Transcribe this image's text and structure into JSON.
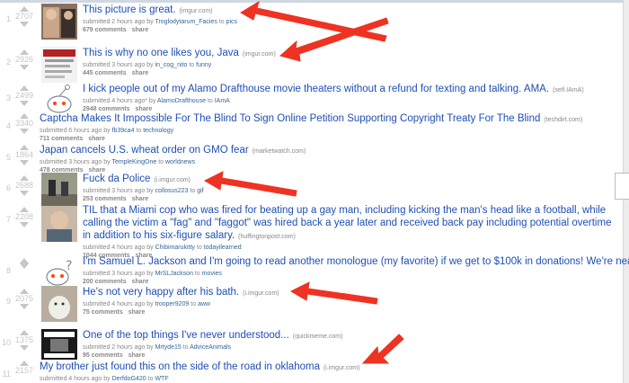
{
  "posts": [
    {
      "rank": "1",
      "score": "2707",
      "title": "This picture is great.",
      "domain": "(imgur.com)",
      "submitted": "submitted 2 hours ago by",
      "author": "Troglodytarum_Facies",
      "to": "to",
      "sub": "pics",
      "comments": "679 comments",
      "share": "share"
    },
    {
      "rank": "2",
      "score": "2926",
      "title": "This is why no one likes you, Java",
      "domain": "(imgur.com)",
      "submitted": "submitted 3 hours ago by",
      "author": "in_cog_nito",
      "to": "to",
      "sub": "funny",
      "comments": "445 comments",
      "share": "share"
    },
    {
      "rank": "3",
      "score": "2499",
      "title": "I kick people out of my Alamo Drafthouse movie theaters without a refund for texting and talking. AMA.",
      "domain": "(self.IAmA)",
      "submitted": "submitted 4 hours ago* by",
      "author": "AlamoDrafthouse",
      "to": "to",
      "sub": "IAmA",
      "comments": "2948 comments",
      "share": "share"
    },
    {
      "rank": "4",
      "score": "3340",
      "title": "Captcha Makes It Impossible For The Blind To Sign Online Petition Supporting Copyright Treaty For The Blind",
      "domain": "(techdirt.com)",
      "submitted": "submitted 6 hours ago by",
      "author": "fb39ca4",
      "to": "to",
      "sub": "technology",
      "comments": "711 comments",
      "share": "share"
    },
    {
      "rank": "5",
      "score": "1864",
      "title": "Japan cancels U.S. wheat order on GMO fear",
      "domain": "(marketwatch.com)",
      "submitted": "submitted 3 hours ago by",
      "author": "TempleKingOne",
      "to": "to",
      "sub": "worldnews",
      "comments": "478 comments",
      "share": "share"
    },
    {
      "rank": "6",
      "score": "2688",
      "title": "Fuck da Police",
      "domain": "(i.imgur.com)",
      "submitted": "submitted 3 hours ago by",
      "author": "collosus223",
      "to": "to",
      "sub": "gif",
      "comments": "253 comments",
      "share": "share"
    },
    {
      "rank": "7",
      "score": "2208",
      "title": "TIL that a Miami cop who was fired for beating up a gay man, including kicking the man's head like a football, while calling the victim a \"fag\" and \"faggot\" was hired back a year later and received back pay including potential overtime in addition to his six-figure salary.",
      "domain": "(huffingtonpost.com)",
      "submitted": "submitted 4 hours ago by",
      "author": "Chibimarukitty",
      "to": "to",
      "sub": "todayilearned",
      "comments": "1044 comments",
      "share": "share"
    },
    {
      "rank": "8",
      "score": "",
      "title": "I'm Samuel L. Jackson and I'm going to read another monologue (my favorite) if we get to $100k in donations! We're near",
      "domain": "",
      "submitted": "submitted 3 hours ago by",
      "author": "MrSLJackson",
      "to": "to",
      "sub": "movies",
      "comments": "200 comments",
      "share": "share"
    },
    {
      "rank": "9",
      "score": "2075",
      "title": "He's not very happy after his bath.",
      "domain": "(i.imgur.com)",
      "submitted": "submitted 4 hours ago by",
      "author": "trooper9209",
      "to": "to",
      "sub": "aww",
      "comments": "75 comments",
      "share": "share"
    },
    {
      "rank": "10",
      "score": "1375",
      "title": "One of the top things I've never understood...",
      "domain": "(quickmeme.com)",
      "submitted": "submitted 2 hours ago by",
      "author": "Mrtyde15",
      "to": "to",
      "sub": "AdviceAnimals",
      "comments": "95 comments",
      "share": "share"
    },
    {
      "rank": "11",
      "score": "2157",
      "title": "My brother just found this on the side of the road in oklahoma",
      "domain": "(i.imgur.com)",
      "submitted": "submitted 4 hours ago by",
      "author": "DerfdoG420",
      "to": "to",
      "sub": "WTF",
      "comments": "",
      "share": ""
    }
  ],
  "colors": {
    "arrow": "#ee3322",
    "link": "#1f4fb3",
    "muted": "#888888"
  },
  "icons": [
    "upvote-arrow-icon",
    "downvote-arrow-icon",
    "reddit-alien-icon",
    "red-arrow-annotation"
  ]
}
